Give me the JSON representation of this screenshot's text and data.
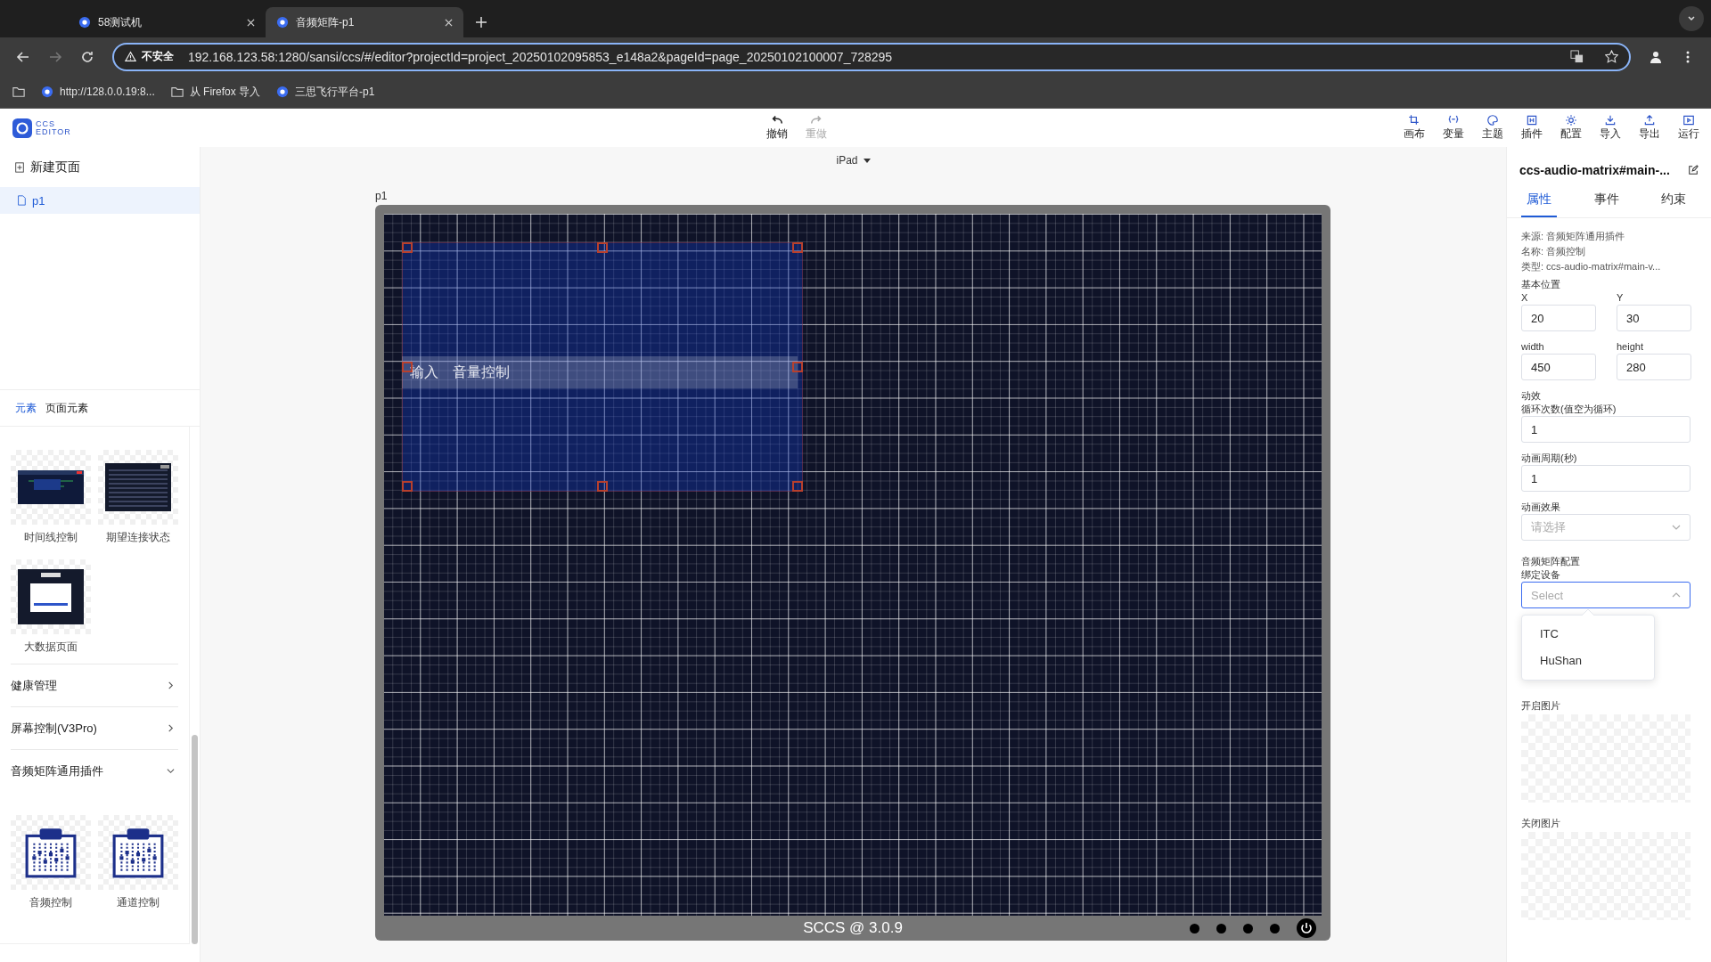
{
  "browser": {
    "tabs": [
      {
        "title": "58测试机",
        "selected": false
      },
      {
        "title": "音频矩阵-p1",
        "selected": true
      }
    ],
    "security": "不安全",
    "url": "192.168.123.58:1280/sansi/ccs/#/editor?projectId=project_20250102095853_e148a2&pageId=page_20250102100007_728295",
    "bookmarks": [
      {
        "label": "http://128.0.0.19:8...",
        "kind": "site"
      },
      {
        "label": "从 Firefox 导入",
        "kind": "folder"
      },
      {
        "label": "三思飞行平台-p1",
        "kind": "site"
      }
    ]
  },
  "header": {
    "logo": [
      "CCS",
      "EDITOR"
    ],
    "history": [
      {
        "label": "撤销",
        "disabled": false
      },
      {
        "label": "重做",
        "disabled": true
      }
    ],
    "tools": [
      "画布",
      "变量",
      "主题",
      "插件",
      "配置",
      "导入",
      "导出",
      "运行"
    ]
  },
  "pages": {
    "new_page": "新建页面",
    "items": [
      {
        "name": "p1",
        "selected": true
      }
    ]
  },
  "element_tabs": [
    {
      "label": "元素",
      "selected": true
    },
    {
      "label": "页面元素",
      "selected": false
    }
  ],
  "components": [
    {
      "label": "时间线控制",
      "kind": "timeline"
    },
    {
      "label": "期望连接状态",
      "kind": "table"
    },
    {
      "label": "大数据页面",
      "kind": "login"
    }
  ],
  "groups": [
    {
      "title": "健康管理",
      "expanded": false
    },
    {
      "title": "屏幕控制(V3Pro)",
      "expanded": false
    },
    {
      "title": "音频矩阵通用插件",
      "expanded": true,
      "items": [
        {
          "label": "音频控制",
          "kind": "mixer"
        },
        {
          "label": "通道控制",
          "kind": "mixer"
        }
      ]
    }
  ],
  "device": "iPad",
  "canvas": {
    "page": "p1",
    "widget": {
      "labels": [
        "输入",
        "音量控制"
      ],
      "selected": true
    },
    "footer": "SCCS @ 3.0.9"
  },
  "inspector": {
    "title": "ccs-audio-matrix#main-...",
    "tabs": [
      {
        "label": "属性",
        "selected": true
      },
      {
        "label": "事件",
        "selected": false
      },
      {
        "label": "约束",
        "selected": false
      }
    ],
    "info": [
      "来源: 音频矩阵通用插件",
      "名称: 音频控制",
      "类型: ccs-audio-matrix#main-v..."
    ],
    "position": {
      "title": "基本位置",
      "fields": [
        {
          "label": "X",
          "value": "20"
        },
        {
          "label": "Y",
          "value": "30"
        },
        {
          "label": "width",
          "value": "450"
        },
        {
          "label": "height",
          "value": "280"
        }
      ]
    },
    "effects": {
      "title": "动效",
      "fields": [
        {
          "label": "循环次数(值空为循环)",
          "value": "1"
        },
        {
          "label": "动画周期(秒)",
          "value": "1"
        }
      ],
      "select": {
        "label": "动画效果",
        "placeholder": "请选择"
      }
    },
    "matrix": {
      "title": "音频矩阵配置",
      "select": {
        "label": "绑定设备",
        "placeholder": "Select",
        "expanded": true,
        "options": [
          "ITC",
          "HuShan"
        ]
      }
    },
    "images": [
      "开启图片",
      "关闭图片"
    ]
  }
}
